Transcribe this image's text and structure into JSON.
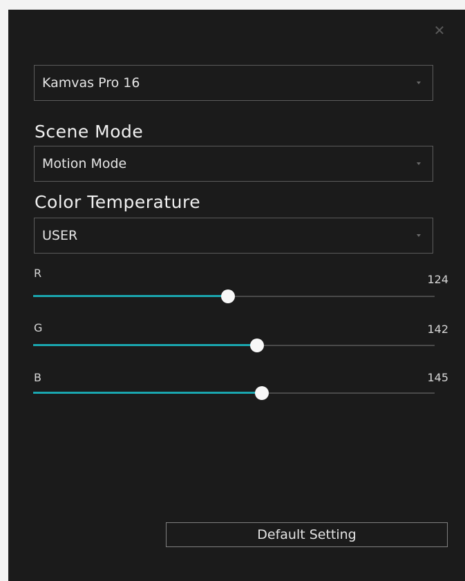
{
  "close_icon": "close-icon",
  "device_select": {
    "value": "Kamvas Pro 16"
  },
  "scene_mode": {
    "label": "Scene Mode",
    "value": "Motion Mode"
  },
  "color_temperature": {
    "label": "Color Temperature",
    "value": "USER"
  },
  "sliders": [
    {
      "name": "r",
      "label": "R",
      "value": "124",
      "level": 0.486,
      "color": "#1aa7b0"
    },
    {
      "name": "g",
      "label": "G",
      "value": "142",
      "level": 0.557,
      "color": "#1aa7b0"
    },
    {
      "name": "b",
      "label": "B",
      "value": "145",
      "level": 0.569,
      "color": "#1aa7b0"
    }
  ],
  "default_button": {
    "label": "Default Setting"
  },
  "colors": {
    "accent": "#1aa7b0",
    "background": "#1b1b1b",
    "thumb": "#f7f7f7"
  }
}
